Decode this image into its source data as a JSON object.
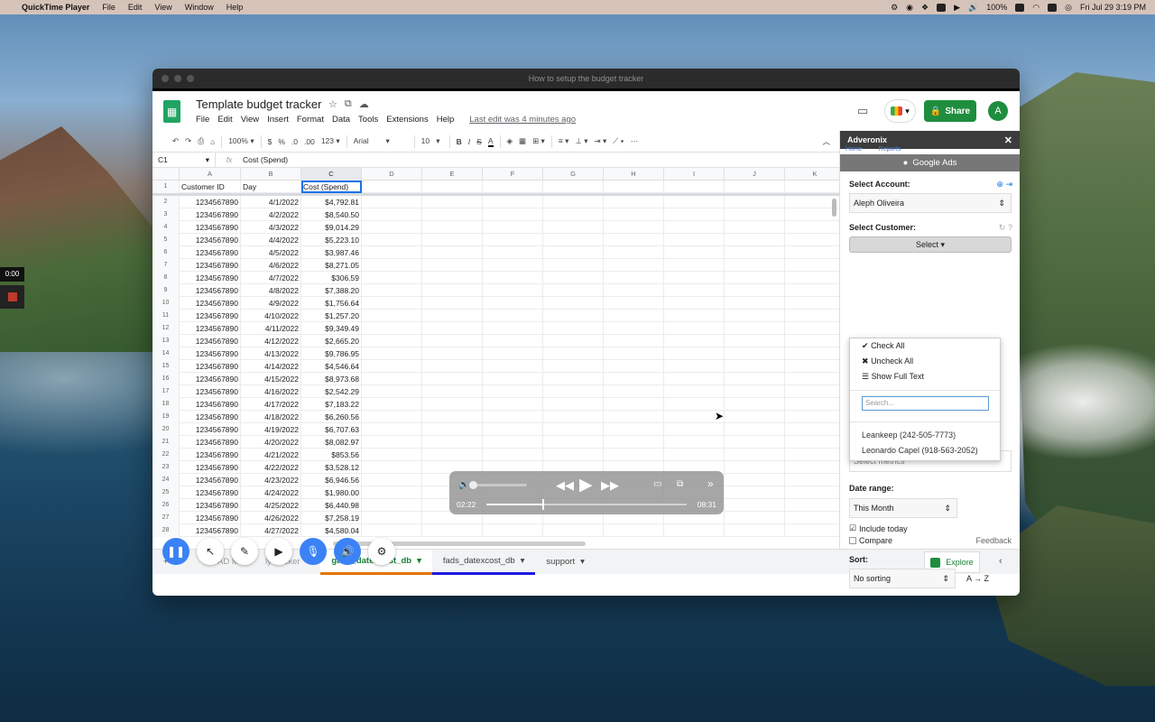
{
  "menubar": {
    "app": "QuickTime Player",
    "items": [
      "File",
      "Edit",
      "View",
      "Window",
      "Help"
    ],
    "battery": "100%",
    "datetime": "Fri Jul 29  3:19 PM"
  },
  "recorder": {
    "time": "0:00"
  },
  "window": {
    "title": "How to setup the budget tracker"
  },
  "sheets": {
    "doc_title": "Template budget tracker",
    "menus": [
      "File",
      "Edit",
      "View",
      "Insert",
      "Format",
      "Data",
      "Tools",
      "Extensions",
      "Help"
    ],
    "last_edit": "Last edit was 4 minutes ago",
    "share_label": "Share",
    "avatar_letter": "A",
    "toolbar": {
      "zoom": "100%",
      "currency": "$",
      "percent": "%",
      "dec_less": ".0",
      "dec_more": ".00",
      "num_format": "123",
      "font": "Arial",
      "size": "10"
    },
    "namebox": "C1",
    "formula": "Cost (Spend)",
    "columns": [
      "A",
      "B",
      "C",
      "D",
      "E",
      "F",
      "G",
      "H",
      "I",
      "J",
      "K"
    ],
    "headers": [
      "Customer ID",
      "Day",
      "Cost (Spend)"
    ],
    "rows": [
      [
        "1234567890",
        "4/1/2022",
        "$4,792.81"
      ],
      [
        "1234567890",
        "4/2/2022",
        "$8,540.50"
      ],
      [
        "1234567890",
        "4/3/2022",
        "$9,014.29"
      ],
      [
        "1234567890",
        "4/4/2022",
        "$5,223.10"
      ],
      [
        "1234567890",
        "4/5/2022",
        "$3,987.46"
      ],
      [
        "1234567890",
        "4/6/2022",
        "$8,271.05"
      ],
      [
        "1234567890",
        "4/7/2022",
        "$306.59"
      ],
      [
        "1234567890",
        "4/8/2022",
        "$7,388.20"
      ],
      [
        "1234567890",
        "4/9/2022",
        "$1,756.64"
      ],
      [
        "1234567890",
        "4/10/2022",
        "$1,257.20"
      ],
      [
        "1234567890",
        "4/11/2022",
        "$9,349.49"
      ],
      [
        "1234567890",
        "4/12/2022",
        "$2,665.20"
      ],
      [
        "1234567890",
        "4/13/2022",
        "$9,786.95"
      ],
      [
        "1234567890",
        "4/14/2022",
        "$4,546.64"
      ],
      [
        "1234567890",
        "4/15/2022",
        "$8,973.68"
      ],
      [
        "1234567890",
        "4/16/2022",
        "$2,542.29"
      ],
      [
        "1234567890",
        "4/17/2022",
        "$7,183.22"
      ],
      [
        "1234567890",
        "4/18/2022",
        "$6,260.56"
      ],
      [
        "1234567890",
        "4/19/2022",
        "$6,707.63"
      ],
      [
        "1234567890",
        "4/20/2022",
        "$8,082.97"
      ],
      [
        "1234567890",
        "4/21/2022",
        "$853.56"
      ],
      [
        "1234567890",
        "4/22/2022",
        "$3,528.12"
      ],
      [
        "1234567890",
        "4/23/2022",
        "$6,946.56"
      ],
      [
        "1234567890",
        "4/24/2022",
        "$1,980.00"
      ],
      [
        "1234567890",
        "4/25/2022",
        "$6,440.98"
      ],
      [
        "1234567890",
        "4/26/2022",
        "$7,258.19"
      ],
      [
        "1234567890",
        "4/27/2022",
        "$4,580.04"
      ]
    ],
    "tabs": [
      {
        "label": "AD Ma",
        "state": "dim"
      },
      {
        "label": "ly tracker",
        "state": "dim"
      },
      {
        "label": "gads_datexcost_db",
        "state": "active"
      },
      {
        "label": "fads_datexcost_db",
        "state": "blue"
      },
      {
        "label": "support",
        "state": "normal"
      }
    ],
    "explore_label": "Explore"
  },
  "panel": {
    "title": "Adveronix",
    "tabs": [
      "Home",
      "Reports"
    ],
    "section": "Google Ads",
    "select_account_label": "Select Account:",
    "account": "Aleph Oliveira",
    "select_customer_label": "Select Customer:",
    "select_btn": "Select",
    "dropdown": {
      "check_all": "Check All",
      "uncheck_all": "Uncheck All",
      "show_full_text": "Show Full Text",
      "search_placeholder": "Search...",
      "options": [
        "Leankeep (242-505-7773)",
        "Leonardo Capel (918-563-2052)"
      ]
    },
    "metrics_placeholder": "Select metrics",
    "date_range_label": "Date range:",
    "date_range": "This Month",
    "include_today": "Include today",
    "compare": "Compare",
    "sort_label": "Sort:",
    "sort_value": "No sorting",
    "sort_dir": "A → Z",
    "feedback": "Feedback"
  },
  "video": {
    "elapsed": "02:22",
    "total": "08:31",
    "progress": 0.28
  }
}
